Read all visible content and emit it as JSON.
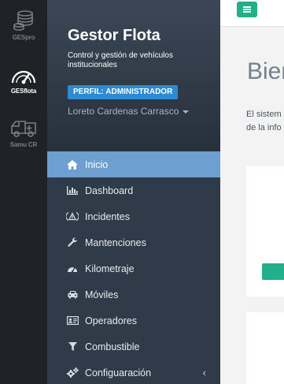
{
  "rail": {
    "items": [
      {
        "label": "GESpro",
        "icon": "database-icon",
        "active": false
      },
      {
        "label": "GESflota",
        "icon": "speedometer-icon",
        "active": true
      },
      {
        "label": "Samu CR",
        "icon": "ambulance-icon",
        "active": false
      }
    ]
  },
  "sidebar": {
    "title": "Gestor Flota",
    "subtitle": "Control y gestión de vehículos institucionales",
    "role_badge": "PERFIL: ADMINISTRADOR",
    "user_name": "Loreto Cardenas Carrasco",
    "menu": [
      {
        "label": "Inicio",
        "icon": "home-icon",
        "active": true
      },
      {
        "label": "Dashboard",
        "icon": "bar-chart-icon",
        "active": false
      },
      {
        "label": "Incidentes",
        "icon": "warning-icon",
        "active": false
      },
      {
        "label": "Mantenciones",
        "icon": "wrench-icon",
        "active": false
      },
      {
        "label": "Kilometraje",
        "icon": "tachometer-icon",
        "active": false
      },
      {
        "label": "Móviles",
        "icon": "car-icon",
        "active": false
      },
      {
        "label": "Operadores",
        "icon": "id-card-icon",
        "active": false
      },
      {
        "label": "Combustible",
        "icon": "filter-icon",
        "active": false
      },
      {
        "label": "Configuaración",
        "icon": "gears-icon",
        "active": false,
        "has_submenu": true
      }
    ]
  },
  "main": {
    "title": "Bien",
    "intro_line1": "El sistem",
    "intro_line2": "de la info"
  },
  "colors": {
    "accent": "#22b08a",
    "active_menu": "#6e9fd1",
    "badge": "#2d8bd3"
  }
}
